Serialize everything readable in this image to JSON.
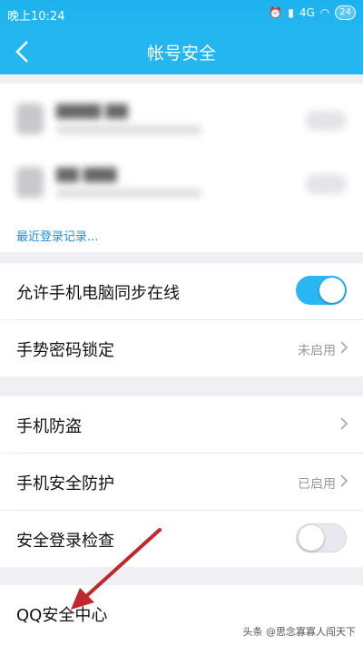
{
  "status": {
    "time": "晚上10:24",
    "signal": "4G",
    "battery": "24"
  },
  "header": {
    "title": "帐号安全"
  },
  "devices": {
    "recent_link": "最近登录记录..."
  },
  "settings": {
    "sync_label": "允许手机电脑同步在线",
    "gesture_label": "手势密码锁定",
    "gesture_value": "未启用",
    "anti_theft_label": "手机防盗",
    "protection_label": "手机安全防护",
    "protection_value": "已启用",
    "login_check_label": "安全登录检查",
    "qq_center_label": "QQ安全中心"
  },
  "toggles": {
    "sync": true,
    "login_check": false
  },
  "watermark": "头条 @思念寡寡人闯天下",
  "colors": {
    "accent": "#23b6f0",
    "link": "#1e8fe0",
    "arrow": "#c0282c"
  }
}
